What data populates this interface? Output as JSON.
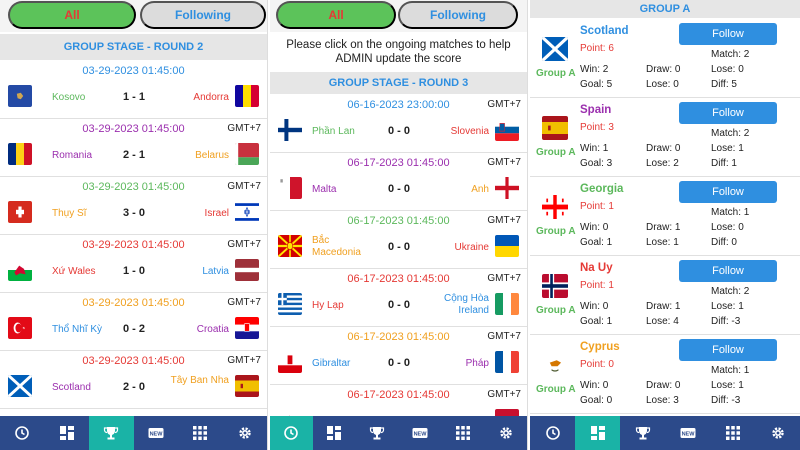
{
  "tabs": {
    "all": "All",
    "following": "Following"
  },
  "panel1": {
    "round_title": "GROUP STAGE - ROUND 2",
    "matches": [
      {
        "date": "03-29-2023 01:45:00",
        "tz": "",
        "home": "Kosovo",
        "score": "1 - 1",
        "away": "Andorra",
        "date_color": "#2f8fe0",
        "home_color": "#5cb85c",
        "away_color": "#e53935"
      },
      {
        "date": "03-29-2023 01:45:00",
        "tz": "GMT+7",
        "home": "Romania",
        "score": "2 - 1",
        "away": "Belarus",
        "date_color": "#9b2fae",
        "home_color": "#9b2fae",
        "away_color": "#f0a020"
      },
      {
        "date": "03-29-2023 01:45:00",
        "tz": "GMT+7",
        "home": "Thụy Sĩ",
        "score": "3 - 0",
        "away": "Israel",
        "date_color": "#5cb85c",
        "home_color": "#f0a020",
        "away_color": "#e53935"
      },
      {
        "date": "03-29-2023 01:45:00",
        "tz": "GMT+7",
        "home": "Xứ Wales",
        "score": "1 - 0",
        "away": "Latvia",
        "date_color": "#e53935",
        "home_color": "#e53935",
        "away_color": "#2f8fe0"
      },
      {
        "date": "03-29-2023 01:45:00",
        "tz": "GMT+7",
        "home": "Thổ Nhĩ Kỳ",
        "score": "0 - 2",
        "away": "Croatia",
        "date_color": "#f0a020",
        "home_color": "#2f8fe0",
        "away_color": "#9b2fae"
      },
      {
        "date": "03-29-2023 01:45:00",
        "tz": "GMT+7",
        "home": "Scotland",
        "score": "2 - 0",
        "away": "Tây Ban Nha",
        "date_color": "#e53935",
        "home_color": "#9b2fae",
        "away_color": "#f0a020"
      }
    ]
  },
  "panel2": {
    "notice": "Please click on the ongoing matches to help ADMIN update the score",
    "round_title": "GROUP STAGE - ROUND 3",
    "matches": [
      {
        "date": "06-16-2023 23:00:00",
        "tz": "GMT+7",
        "home": "Phần Lan",
        "score": "0 - 0",
        "away": "Slovenia",
        "date_color": "#2f8fe0",
        "home_color": "#5cb85c",
        "away_color": "#e53935"
      },
      {
        "date": "06-17-2023 01:45:00",
        "tz": "GMT+7",
        "home": "Malta",
        "score": "0 - 0",
        "away": "Anh",
        "date_color": "#9b2fae",
        "home_color": "#9b2fae",
        "away_color": "#f0a020"
      },
      {
        "date": "06-17-2023 01:45:00",
        "tz": "GMT+7",
        "home": "Bắc Macedonia",
        "score": "0 - 0",
        "away": "Ukraine",
        "date_color": "#5cb85c",
        "home_color": "#f0a020",
        "away_color": "#e53935"
      },
      {
        "date": "06-17-2023 01:45:00",
        "tz": "GMT+7",
        "home": "Hy Lạp",
        "score": "0 - 0",
        "away": "Cộng Hòa Ireland",
        "date_color": "#e53935",
        "home_color": "#e53935",
        "away_color": "#2f8fe0"
      },
      {
        "date": "06-17-2023 01:45:00",
        "tz": "GMT+7",
        "home": "Gibraltar",
        "score": "0 - 0",
        "away": "Pháp",
        "date_color": "#f0a020",
        "home_color": "#2f8fe0",
        "away_color": "#9b2fae"
      },
      {
        "date": "06-17-2023 01:45:00",
        "tz": "GMT+7",
        "home": "",
        "score": "",
        "away": "",
        "date_color": "#e53935",
        "home_color": "#9b2fae",
        "away_color": "#f0a020"
      }
    ]
  },
  "panel3": {
    "group_title": "GROUP A",
    "follow_label": "Follow",
    "teams": [
      {
        "name": "Scotland",
        "name_color": "#2f8fe0",
        "group": "Group A",
        "point": "Point: 6",
        "match": "Match: 2",
        "win": "Win: 2",
        "draw": "Draw: 0",
        "lose": "Lose: 0",
        "goal": "Goal: 5",
        "lose_goal": "Lose: 0",
        "diff": "Diff: 5"
      },
      {
        "name": "Spain",
        "name_color": "#9b2fae",
        "group": "Group A",
        "point": "Point: 3",
        "match": "Match: 2",
        "win": "Win: 1",
        "draw": "Draw: 0",
        "lose": "Lose: 1",
        "goal": "Goal: 3",
        "lose_goal": "Lose: 2",
        "diff": "Diff: 1"
      },
      {
        "name": "Georgia",
        "name_color": "#5cb85c",
        "group": "Group A",
        "point": "Point: 1",
        "match": "Match: 1",
        "win": "Win: 0",
        "draw": "Draw: 1",
        "lose": "Lose: 0",
        "goal": "Goal: 1",
        "lose_goal": "Lose: 1",
        "diff": "Diff: 0"
      },
      {
        "name": "Na Uy",
        "name_color": "#e53935",
        "group": "Group A",
        "point": "Point: 1",
        "match": "Match: 2",
        "win": "Win: 0",
        "draw": "Draw: 1",
        "lose": "Lose: 1",
        "goal": "Goal: 1",
        "lose_goal": "Lose: 4",
        "diff": "Diff: -3"
      },
      {
        "name": "Cyprus",
        "name_color": "#f0a020",
        "group": "Group A",
        "point": "Point: 0",
        "match": "Match: 1",
        "win": "Win: 0",
        "draw": "Draw: 0",
        "lose": "Lose: 1",
        "goal": "Goal: 0",
        "lose_goal": "Lose: 3",
        "diff": "Diff: -3"
      }
    ]
  },
  "nav": {
    "items": [
      "clock-icon",
      "dashboard-icon",
      "trophy-icon",
      "new-icon",
      "grid-icon",
      "gear-icon"
    ],
    "new_label": "NEW",
    "active_panel1": 2,
    "active_panel2": 0,
    "active_panel3": 1
  }
}
